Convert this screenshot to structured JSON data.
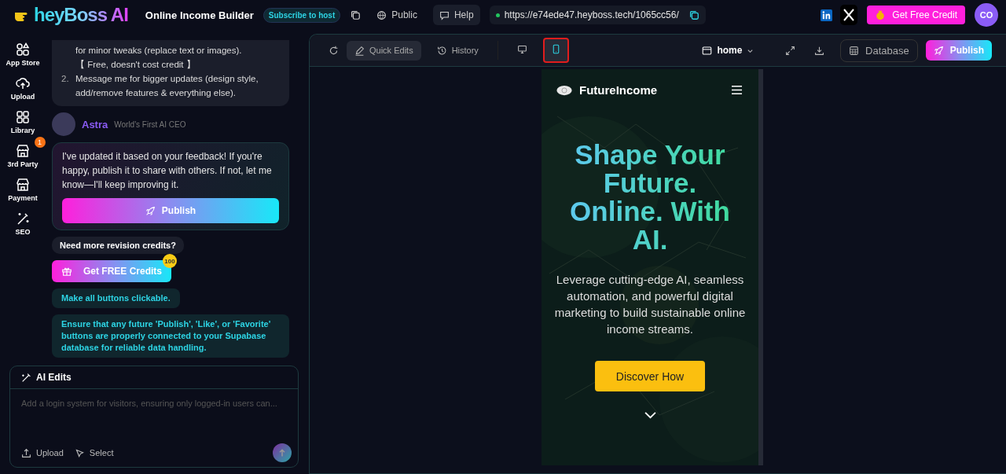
{
  "top_bar": {
    "logo_text": "heyBoss AI",
    "project_title": "Online Income Builder",
    "subscribe_badge": "Subscribe to host",
    "visibility": "Public",
    "help": "Help",
    "url": "https://e74ede47.heyboss.tech/1065cc56/",
    "credit_button": "Get Free Credit",
    "avatar_initials": "CO"
  },
  "sidebar": {
    "items": [
      {
        "label": "App Store"
      },
      {
        "label": "Upload"
      },
      {
        "label": "Library"
      },
      {
        "label": "3rd Party",
        "badge": "1"
      },
      {
        "label": "Payment"
      },
      {
        "label": "SEO"
      }
    ]
  },
  "chat": {
    "instructions": [
      {
        "text": "for minor tweaks (replace text or images).",
        "note": "【 Free, doesn't cost credit 】"
      },
      {
        "number": "2.",
        "text": "Message me for bigger updates (design style, add/remove features & everything else)."
      }
    ],
    "agent": {
      "name": "Astra",
      "role": "World's First AI CEO"
    },
    "reply": {
      "text": "I've updated it based on your feedback! If you're happy, publish it to share with others. If not, let me know—I'll keep improving it.",
      "button": "Publish"
    },
    "credits_question": "Need more revision credits?",
    "credits_button": {
      "label": "Get FREE Credits",
      "badge": "100"
    },
    "suggestions": [
      "Make all buttons clickable.",
      "Ensure that any future 'Publish', 'Like', or 'Favorite' buttons are properly connected to your Supabase database for reliable data handling."
    ]
  },
  "ai_edits": {
    "title": "AI Edits",
    "placeholder": "Add a login system for visitors, ensuring only logged-in users can...",
    "actions": [
      "Upload",
      "Select"
    ]
  },
  "toolbar": {
    "quick_edits": {
      "label": "Quick Edits",
      "selected": true
    },
    "history": "History",
    "devices": [
      {
        "kind": "desktop",
        "selected": false
      },
      {
        "kind": "mobile",
        "selected": true
      }
    ],
    "page": "home",
    "database": "Database",
    "publish": "Publish"
  },
  "preview": {
    "brand": "FutureIncome",
    "headline": "Shape Your Future. Online. With AI.",
    "subtitle": "Leverage cutting-edge AI, seamless automation, and powerful digital marketing to build sustainable online income streams.",
    "cta": "Discover How"
  }
}
